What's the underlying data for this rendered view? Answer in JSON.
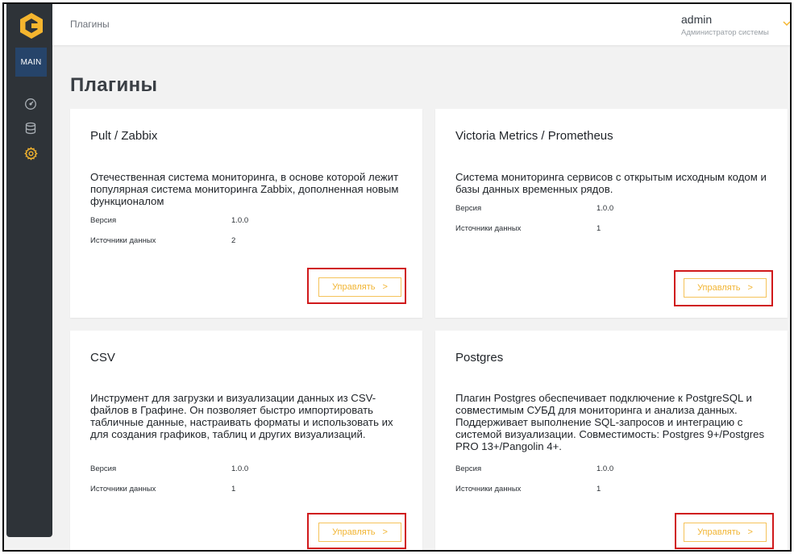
{
  "sidebar": {
    "main_label": "MAIN",
    "items": [
      {
        "icon": "dashboard-gauge-icon"
      },
      {
        "icon": "database-icon"
      },
      {
        "icon": "gear-icon",
        "active": true
      }
    ],
    "active_color": "#f5b52e"
  },
  "topbar": {
    "breadcrumb": "Плагины",
    "user_name": "admin",
    "user_role": "Администратор системы"
  },
  "page_title": "Плагины",
  "labels": {
    "version": "Версия",
    "sources": "Источники данных",
    "manage": "Управлять",
    "manage_chevron": ">"
  },
  "cards": [
    {
      "title": "Pult / Zabbix",
      "description": "Отечественная система мониторинга, в основе которой лежит популярная система мониторинга Zabbix, дополненная новым функционалом",
      "version": "1.0.0",
      "sources": "2"
    },
    {
      "title": "Victoria Metrics / Prometheus",
      "description": "Система мониторинга сервисов с открытым исходным кодом и базы данных временных рядов.",
      "version": "1.0.0",
      "sources": "1"
    },
    {
      "title": "CSV",
      "description": "Инструмент для загрузки и визуализации данных из CSV-файлов в Графине. Он позволяет быстро импортировать табличные данные, настраивать форматы и использовать их для создания графиков, таблиц и других визуализаций.",
      "version": "1.0.0",
      "sources": "1"
    },
    {
      "title": "Postgres",
      "description": "Плагин Postgres обеспечивает подключение к PostgreSQL и совместимым СУБД для мониторинга и анализа данных. Поддерживает выполнение SQL-запросов и интеграцию с системой визуализации. Совместимость: Postgres 9+/Postgres PRO 13+/Pangolin 4+.",
      "version": "1.0.0",
      "sources": "1"
    }
  ],
  "colors": {
    "accent": "#f5b52e",
    "highlight": "#d0191b",
    "sidebar_bg": "#2e3338"
  }
}
